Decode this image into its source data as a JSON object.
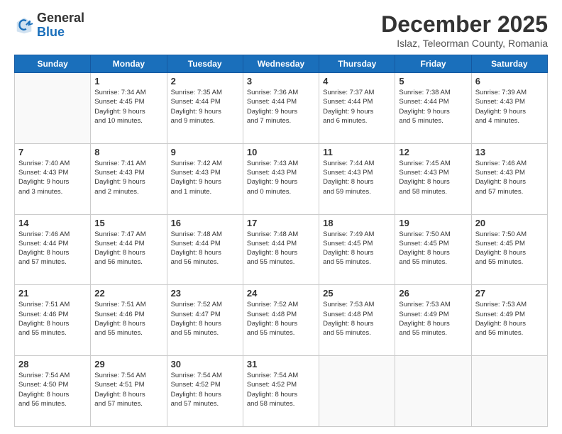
{
  "header": {
    "logo": {
      "line1": "General",
      "line2": "Blue"
    },
    "title": "December 2025",
    "location": "Islaz, Teleorman County, Romania"
  },
  "days_of_week": [
    "Sunday",
    "Monday",
    "Tuesday",
    "Wednesday",
    "Thursday",
    "Friday",
    "Saturday"
  ],
  "weeks": [
    [
      {
        "day": "",
        "info": ""
      },
      {
        "day": "1",
        "info": "Sunrise: 7:34 AM\nSunset: 4:45 PM\nDaylight: 9 hours\nand 10 minutes."
      },
      {
        "day": "2",
        "info": "Sunrise: 7:35 AM\nSunset: 4:44 PM\nDaylight: 9 hours\nand 9 minutes."
      },
      {
        "day": "3",
        "info": "Sunrise: 7:36 AM\nSunset: 4:44 PM\nDaylight: 9 hours\nand 7 minutes."
      },
      {
        "day": "4",
        "info": "Sunrise: 7:37 AM\nSunset: 4:44 PM\nDaylight: 9 hours\nand 6 minutes."
      },
      {
        "day": "5",
        "info": "Sunrise: 7:38 AM\nSunset: 4:44 PM\nDaylight: 9 hours\nand 5 minutes."
      },
      {
        "day": "6",
        "info": "Sunrise: 7:39 AM\nSunset: 4:43 PM\nDaylight: 9 hours\nand 4 minutes."
      }
    ],
    [
      {
        "day": "7",
        "info": "Sunrise: 7:40 AM\nSunset: 4:43 PM\nDaylight: 9 hours\nand 3 minutes."
      },
      {
        "day": "8",
        "info": "Sunrise: 7:41 AM\nSunset: 4:43 PM\nDaylight: 9 hours\nand 2 minutes."
      },
      {
        "day": "9",
        "info": "Sunrise: 7:42 AM\nSunset: 4:43 PM\nDaylight: 9 hours\nand 1 minute."
      },
      {
        "day": "10",
        "info": "Sunrise: 7:43 AM\nSunset: 4:43 PM\nDaylight: 9 hours\nand 0 minutes."
      },
      {
        "day": "11",
        "info": "Sunrise: 7:44 AM\nSunset: 4:43 PM\nDaylight: 8 hours\nand 59 minutes."
      },
      {
        "day": "12",
        "info": "Sunrise: 7:45 AM\nSunset: 4:43 PM\nDaylight: 8 hours\nand 58 minutes."
      },
      {
        "day": "13",
        "info": "Sunrise: 7:46 AM\nSunset: 4:43 PM\nDaylight: 8 hours\nand 57 minutes."
      }
    ],
    [
      {
        "day": "14",
        "info": "Sunrise: 7:46 AM\nSunset: 4:44 PM\nDaylight: 8 hours\nand 57 minutes."
      },
      {
        "day": "15",
        "info": "Sunrise: 7:47 AM\nSunset: 4:44 PM\nDaylight: 8 hours\nand 56 minutes."
      },
      {
        "day": "16",
        "info": "Sunrise: 7:48 AM\nSunset: 4:44 PM\nDaylight: 8 hours\nand 56 minutes."
      },
      {
        "day": "17",
        "info": "Sunrise: 7:48 AM\nSunset: 4:44 PM\nDaylight: 8 hours\nand 55 minutes."
      },
      {
        "day": "18",
        "info": "Sunrise: 7:49 AM\nSunset: 4:45 PM\nDaylight: 8 hours\nand 55 minutes."
      },
      {
        "day": "19",
        "info": "Sunrise: 7:50 AM\nSunset: 4:45 PM\nDaylight: 8 hours\nand 55 minutes."
      },
      {
        "day": "20",
        "info": "Sunrise: 7:50 AM\nSunset: 4:45 PM\nDaylight: 8 hours\nand 55 minutes."
      }
    ],
    [
      {
        "day": "21",
        "info": "Sunrise: 7:51 AM\nSunset: 4:46 PM\nDaylight: 8 hours\nand 55 minutes."
      },
      {
        "day": "22",
        "info": "Sunrise: 7:51 AM\nSunset: 4:46 PM\nDaylight: 8 hours\nand 55 minutes."
      },
      {
        "day": "23",
        "info": "Sunrise: 7:52 AM\nSunset: 4:47 PM\nDaylight: 8 hours\nand 55 minutes."
      },
      {
        "day": "24",
        "info": "Sunrise: 7:52 AM\nSunset: 4:48 PM\nDaylight: 8 hours\nand 55 minutes."
      },
      {
        "day": "25",
        "info": "Sunrise: 7:53 AM\nSunset: 4:48 PM\nDaylight: 8 hours\nand 55 minutes."
      },
      {
        "day": "26",
        "info": "Sunrise: 7:53 AM\nSunset: 4:49 PM\nDaylight: 8 hours\nand 55 minutes."
      },
      {
        "day": "27",
        "info": "Sunrise: 7:53 AM\nSunset: 4:49 PM\nDaylight: 8 hours\nand 56 minutes."
      }
    ],
    [
      {
        "day": "28",
        "info": "Sunrise: 7:54 AM\nSunset: 4:50 PM\nDaylight: 8 hours\nand 56 minutes."
      },
      {
        "day": "29",
        "info": "Sunrise: 7:54 AM\nSunset: 4:51 PM\nDaylight: 8 hours\nand 57 minutes."
      },
      {
        "day": "30",
        "info": "Sunrise: 7:54 AM\nSunset: 4:52 PM\nDaylight: 8 hours\nand 57 minutes."
      },
      {
        "day": "31",
        "info": "Sunrise: 7:54 AM\nSunset: 4:52 PM\nDaylight: 8 hours\nand 58 minutes."
      },
      {
        "day": "",
        "info": ""
      },
      {
        "day": "",
        "info": ""
      },
      {
        "day": "",
        "info": ""
      }
    ]
  ]
}
